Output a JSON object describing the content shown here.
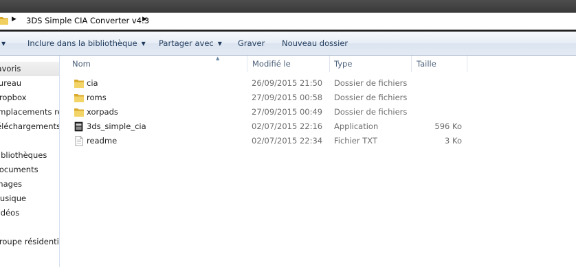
{
  "address": {
    "path": "3DS Simple CIA Converter v4.3"
  },
  "toolbar": {
    "include": "Inclure dans la bibliothèque",
    "share": "Partager avec",
    "burn": "Graver",
    "new_folder": "Nouveau dossier"
  },
  "nav": {
    "items": [
      {
        "label": "Favoris"
      },
      {
        "label": "Bureau"
      },
      {
        "label": "Dropbox"
      },
      {
        "label": "Emplacements récents"
      },
      {
        "label": "Téléchargements"
      },
      {
        "label": ""
      },
      {
        "label": "Bibliothèques"
      },
      {
        "label": "Documents"
      },
      {
        "label": "Images"
      },
      {
        "label": "Musique"
      },
      {
        "label": "Vidéos"
      },
      {
        "label": ""
      },
      {
        "label": "Groupe résidentiel"
      }
    ]
  },
  "columns": {
    "name": "Nom",
    "modified": "Modifié le",
    "type": "Type",
    "size": "Taille"
  },
  "files": [
    {
      "name": "cia",
      "modified": "26/09/2015 21:50",
      "type": "Dossier de fichiers",
      "size": "",
      "icon": "folder-icon"
    },
    {
      "name": "roms",
      "modified": "27/09/2015 00:58",
      "type": "Dossier de fichiers",
      "size": "",
      "icon": "folder-icon"
    },
    {
      "name": "xorpads",
      "modified": "27/09/2015 00:49",
      "type": "Dossier de fichiers",
      "size": "",
      "icon": "folder-icon"
    },
    {
      "name": "3ds_simple_cia",
      "modified": "02/07/2015 22:16",
      "type": "Application",
      "size": "596 Ko",
      "icon": "application-icon"
    },
    {
      "name": "readme",
      "modified": "02/07/2015 22:34",
      "type": "Fichier TXT",
      "size": "3 Ko",
      "icon": "text-file-icon"
    }
  ],
  "colors": {
    "title_bar": "#2b2b2b",
    "command_bar": "#e3eaf4",
    "command_text": "#1e395b",
    "header_text": "#4c607a",
    "folder": "#e8c04a"
  }
}
